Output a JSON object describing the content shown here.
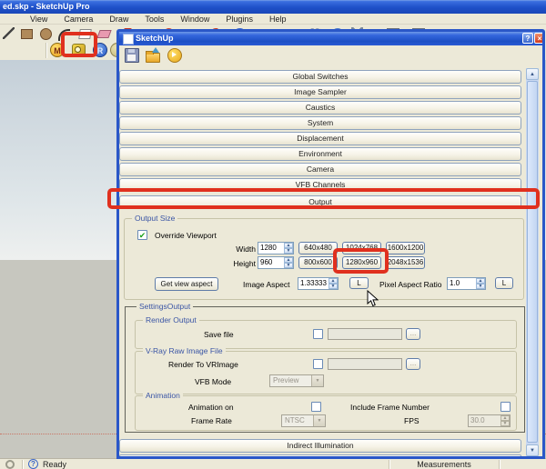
{
  "window": {
    "title": "ed.skp - SketchUp Pro"
  },
  "menubar": {
    "items": [
      "View",
      "Camera",
      "Draw",
      "Tools",
      "Window",
      "Plugins",
      "Help"
    ]
  },
  "vray_toolbar": {
    "material_editor": "M",
    "render": "R"
  },
  "dialog": {
    "title": "SketchUp",
    "rollouts": [
      "Global Switches",
      "Image Sampler",
      "Caustics",
      "System",
      "Displacement",
      "Environment",
      "Camera",
      "VFB Channels",
      "Output"
    ],
    "bottom_rollout": "Indirect Illumination",
    "output_size": {
      "label": "Output Size",
      "override_viewport": "Override Viewport",
      "width_label": "Width",
      "width_value": "1280",
      "height_label": "Height",
      "height_value": "960",
      "presets_row1": [
        "640x480",
        "1024x768",
        "1600x1200"
      ],
      "presets_row2": [
        "800x600",
        "1280x960",
        "2048x1536"
      ],
      "get_view_aspect": "Get view aspect",
      "image_aspect_label": "Image Aspect",
      "image_aspect_value": "1.33333",
      "pixel_aspect_label": "Pixel Aspect Ratio",
      "pixel_aspect_value": "1.0",
      "lock_label": "L"
    },
    "settings_output": {
      "label": "SettingsOutput",
      "render_output": {
        "label": "Render Output",
        "save_file_label": "Save file",
        "browse_label": "..."
      },
      "vray_raw": {
        "label": "V-Ray Raw Image File",
        "render_to_vrimage_label": "Render To VRImage",
        "browse_label": "...",
        "vfb_mode_label": "VFB Mode",
        "vfb_mode_value": "Preview"
      },
      "animation": {
        "label": "Animation",
        "animation_on_label": "Animation on",
        "include_frame_label": "Include Frame Number",
        "frame_rate_label": "Frame Rate",
        "frame_rate_value": "NTSC",
        "fps_label": "FPS",
        "fps_value": "30.0"
      }
    }
  },
  "statusbar": {
    "ready": "Ready",
    "measurements_label": "Measurements"
  },
  "icons": {
    "check": "✔",
    "arrow_up": "▲",
    "arrow_down": "▼",
    "combo_arrow": "▼",
    "help": "?",
    "close": "×"
  },
  "colors": {
    "annotation_red": "#e0301e",
    "titlebar_blue": "#2a57c8",
    "dialog_bg": "#ece9d8"
  }
}
